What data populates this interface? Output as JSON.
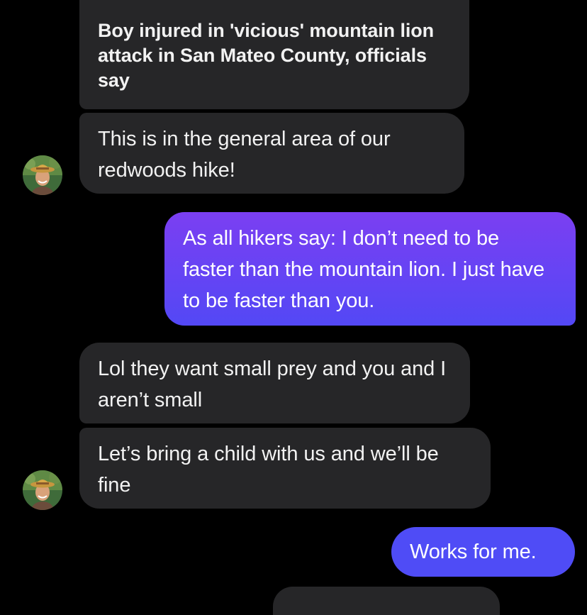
{
  "thread": {
    "messages": [
      {
        "id": "m1",
        "direction": "incoming",
        "kind": "link-preview",
        "text": "Boy injured in 'vicious' mountain lion attack in San Mateo County, officials say"
      },
      {
        "id": "m2",
        "direction": "incoming",
        "kind": "text",
        "text": "This is in the general area of our redwoods hike!"
      },
      {
        "id": "m3",
        "direction": "outgoing",
        "kind": "text",
        "text": "As all hikers say: I don’t need to be faster than the mountain lion. I just have to be faster than you."
      },
      {
        "id": "m4",
        "direction": "incoming",
        "kind": "text",
        "text": "Lol they want small prey and you and I aren’t small"
      },
      {
        "id": "m5",
        "direction": "incoming",
        "kind": "text",
        "text": "Let’s bring a child with us and we’ll be fine"
      },
      {
        "id": "m6",
        "direction": "outgoing",
        "kind": "text",
        "text": "Works for me."
      }
    ]
  },
  "colors": {
    "background": "#000000",
    "incoming_bubble": "#262628",
    "outgoing_gradient_top": "#7b3ff2",
    "outgoing_gradient_bottom": "#4f4cf6",
    "text": "#f2f2f2"
  },
  "avatar": {
    "icon": "contact-avatar-icon"
  }
}
